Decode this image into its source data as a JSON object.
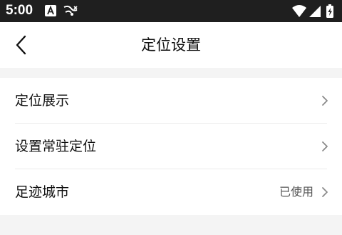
{
  "status_bar": {
    "time": "5:00",
    "left_icons": [
      "a-badge-icon",
      "cast-icon"
    ],
    "right_icons": [
      "wifi-icon",
      "signal-icon",
      "battery-charging-icon"
    ]
  },
  "header": {
    "title": "定位设置",
    "back_icon": "back-arrow-icon"
  },
  "settings": {
    "items": [
      {
        "label": "定位展示",
        "value": ""
      },
      {
        "label": "设置常驻定位",
        "value": ""
      },
      {
        "label": "足迹城市",
        "value": "已使用"
      }
    ]
  },
  "colors": {
    "status_bar_bg": "#1f1f1f",
    "page_bg": "#f4f4f4",
    "card_bg": "#ffffff",
    "text": "#111111",
    "secondary_text": "#555555",
    "chevron": "#8a8a8a"
  }
}
